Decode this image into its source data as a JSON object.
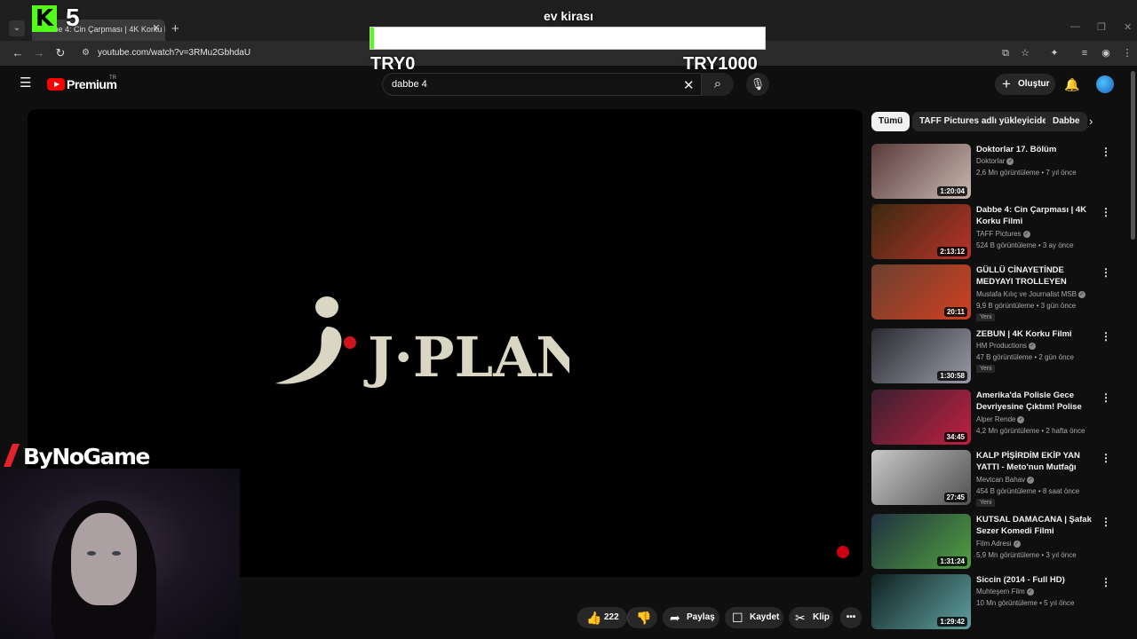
{
  "browser": {
    "tab_title": "Dabbe 4: Cin Çarpması | 4K Korku Filmi",
    "url": "youtube.com/watch?v=3RMu2GbhdaU"
  },
  "overlay": {
    "kick_count": "5",
    "goal_title": "ev kirası",
    "goal_min": "TRY0",
    "goal_max": "TRY1000",
    "goal_progress_fraction": 0.01,
    "sponsor_name": "ByNoGame"
  },
  "youtube": {
    "logo_text": "Premium",
    "region": "TR",
    "search_value": "dabbe 4",
    "create_label": "Oluştur"
  },
  "player": {
    "logo_text": "J·PLAN"
  },
  "actions": {
    "likes": "222",
    "share": "Paylaş",
    "save": "Kaydet",
    "clip": "Klip"
  },
  "chips": [
    "Tümü",
    "TAFF Pictures adlı yükleyiciden",
    "Dabbe"
  ],
  "recommendations": [
    {
      "title": "Doktorlar 17. Bölüm",
      "channel": "Doktorlar",
      "meta": "2,6 Mn görüntüleme • 7 yıl önce",
      "duration": "1:20:04",
      "badge": "",
      "thumb_colors": [
        "#5a3a3a",
        "#c8b8b0"
      ]
    },
    {
      "title": "Dabbe 4: Cin Çarpması | 4K Korku Filmi",
      "channel": "TAFF Pictures",
      "meta": "524 B görüntüleme • 3 ay önce",
      "duration": "2:13:12",
      "badge": "",
      "thumb_colors": [
        "#3b2a10",
        "#b8322a"
      ]
    },
    {
      "title": "GÜLLÜ CİNAYETİNDE MEDYAYI TROLLEYEN KADININ GERÇEK...",
      "channel": "Mustafa Kılıç  ve Journalist MSB",
      "meta": "9,9 B görüntüleme • 3 gün önce",
      "duration": "20:11",
      "badge": "Yeni",
      "thumb_colors": [
        "#6a4030",
        "#d04020"
      ]
    },
    {
      "title": "ZEBUN | 4K Korku Filmi",
      "channel": "HM Productions",
      "meta": "47 B görüntüleme • 2 gün önce",
      "duration": "1:30:58",
      "badge": "Yeni",
      "thumb_colors": [
        "#2a2a30",
        "#9a9aa8"
      ]
    },
    {
      "title": "Amerika'da Polisle Gece Devriyesine Çıktım! Polise Küf...",
      "channel": "Alper Rende",
      "meta": "4,2 Mn görüntüleme • 2 hafta önce",
      "duration": "34:45",
      "badge": "",
      "thumb_colors": [
        "#3a2030",
        "#c02040"
      ]
    },
    {
      "title": "KALP PİŞİRDİM EKİP YAN YATTI - Meto'nun Mutfağı",
      "channel": "Mevtcan Bahav",
      "meta": "454 B görüntüleme • 8 saat önce",
      "duration": "27:45",
      "badge": "Yeni",
      "thumb_colors": [
        "#c8c8c8",
        "#505050"
      ]
    },
    {
      "title": "KUTSAL DAMACANA  | Şafak Sezer Komedi Filmi",
      "channel": "Film Adresi",
      "meta": "5,9 Mn görüntüleme • 3 yıl önce",
      "duration": "1:31:24",
      "badge": "",
      "thumb_colors": [
        "#203040",
        "#50a040"
      ]
    },
    {
      "title": "Siccin (2014 - Full HD)",
      "channel": "Muhteşem Film",
      "meta": "10 Mn görüntüleme • 5 yıl önce",
      "duration": "1:29:42",
      "badge": "",
      "thumb_colors": [
        "#102020",
        "#60a0a0"
      ]
    }
  ]
}
